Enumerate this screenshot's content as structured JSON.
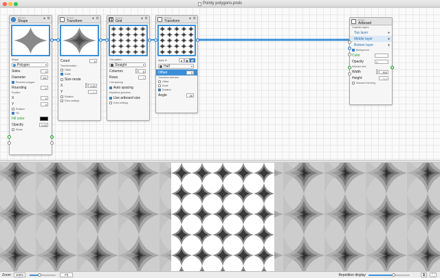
{
  "window": {
    "title": "Pointy polygons.pnds"
  },
  "colors": {
    "accent": "#3b8fd6",
    "close": "#fc605c",
    "min": "#fdbc40",
    "max": "#34c84a"
  },
  "shape_node": {
    "subtitle": "Element",
    "title": "Shape",
    "shape_label": "Shape",
    "shape_value": "Polygon",
    "sides_label": "Sides",
    "sides": "4",
    "diameter_label": "Diameter",
    "diameter": "111",
    "rounded_label": "Rounded polygon",
    "rounding_label": "Rounding",
    "rounding": "-1",
    "position_label": "Position",
    "x_label": "X",
    "x": "0",
    "y_label": "Y",
    "y": "0",
    "rotation_label": "Rotation",
    "fill_label": "Fill",
    "fill_color_label": "Fill color",
    "opacity_label": "Opacity",
    "opacity": "0.43",
    "stroke_label": "Stroke"
  },
  "transform_node": {
    "subtitle": "Repeat",
    "title": "Transform",
    "count_label": "Count",
    "count": "4",
    "transformation_label": "Transformation",
    "offset_label": "Offset",
    "scale_label": "Scale",
    "size_mode_label": "Size mode",
    "x_label": "X",
    "x": "0.53",
    "y_label": "Y",
    "y": "0.53",
    "rotation_label": "Rotation",
    "extra_label": "Extra settings"
  },
  "grid_node": {
    "subtitle": "Repeat",
    "title": "Grid",
    "pattern_label": "Grid pattern",
    "pattern_value": "Straight",
    "columns_label": "Columns",
    "columns": "5",
    "rows_label": "Rows",
    "rows": "5",
    "spacing_label": "Grid spacing",
    "auto_spacing_label": "Auto spacing",
    "area_label": "Repetition grid area",
    "artboard_size_label": "Use artboard size",
    "extra_label": "Extra settings"
  },
  "change_node": {
    "subtitle": "Change",
    "title": "Transform",
    "apply_label": "Apply to",
    "half_value": "Half",
    "offset_label": "Offset",
    "offset": "0",
    "selected_label": "Transform selected",
    "offset_cb_label": "Offset",
    "scale_cb_label": "Scale",
    "rotation_cb_label": "Rotation",
    "angle_label": "Angle",
    "angle": "45"
  },
  "artboard_node": {
    "subtitle": "Output",
    "title": "Artboard",
    "layers_label": "Graphics layers",
    "layers": [
      "Top layer",
      "Middle layer",
      "Bottom layer"
    ],
    "background_label": "Background",
    "color_label": "Color",
    "opacity_label": "Opacity",
    "opacity": "1",
    "artboard_size_label": "Artboard size",
    "width_label": "Width",
    "width": "300",
    "height_label": "Height",
    "height": "300",
    "mirroring_label": "Artboard mirroring"
  },
  "statusbar": {
    "zoom_label": "Zoom",
    "zoom_value": "100%",
    "fit_label": "Fit",
    "repetition_label": "Repetition display",
    "repetition_level": 0.6
  }
}
